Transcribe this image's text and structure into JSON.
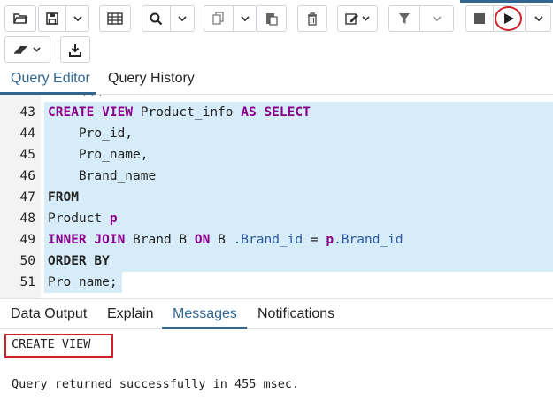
{
  "toolbar": {
    "accent_color": "#326690",
    "highlight_color": "#d0202a",
    "buttons": [
      {
        "name": "open-file-icon"
      },
      {
        "name": "save-icon"
      },
      {
        "name": "table-icon"
      },
      {
        "name": "search-icon"
      },
      {
        "name": "copy-icon"
      },
      {
        "name": "paste-icon"
      },
      {
        "name": "delete-icon"
      },
      {
        "name": "edit-icon"
      },
      {
        "name": "filter-icon"
      },
      {
        "name": "stop-icon"
      },
      {
        "name": "play-icon"
      },
      {
        "name": "eraser-icon"
      },
      {
        "name": "download-icon"
      }
    ]
  },
  "editor_tabs": [
    {
      "label": "Query Editor",
      "active": true
    },
    {
      "label": "Query History",
      "active": false
    }
  ],
  "editor": {
    "lines": [
      {
        "num": "43"
      },
      {
        "num": "44",
        "text": "    Pro_id,"
      },
      {
        "num": "45",
        "text": "    Pro_name,"
      },
      {
        "num": "46",
        "text": "    Brand_name"
      },
      {
        "num": "47",
        "kw": "FROM"
      },
      {
        "num": "48",
        "text": "Product "
      },
      {
        "num": "49"
      },
      {
        "num": "50",
        "kw": "ORDER BY"
      },
      {
        "num": "51",
        "text": "Pro_name;"
      }
    ],
    "line43": {
      "kw1": "CREATE VIEW",
      "t1": " Product_info ",
      "kw2": "AS SELECT"
    },
    "line48": {
      "alias": "p"
    },
    "line49": {
      "kw1": "INNER JOIN",
      "t1": " Brand B ",
      "kw2": "ON",
      "t2": " B ",
      "p1": ".Brand_id",
      "t3": " = ",
      "kw3": "p",
      "p2": ".Brand_id"
    },
    "partial_top": "));"
  },
  "result_tabs": [
    {
      "label": "Data Output",
      "active": false
    },
    {
      "label": "Explain",
      "active": false
    },
    {
      "label": "Messages",
      "active": true
    },
    {
      "label": "Notifications",
      "active": false
    }
  ],
  "messages": {
    "line1": "CREATE VIEW",
    "line2": "Query returned successfully in 455 msec."
  }
}
